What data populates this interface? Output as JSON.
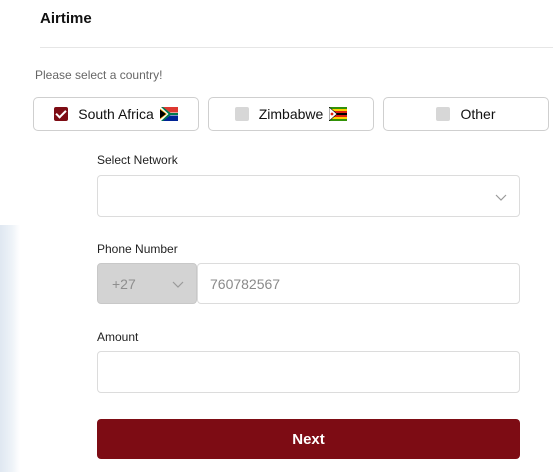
{
  "header": {
    "title": "Airtime"
  },
  "country_select": {
    "prompt": "Please select a country!",
    "options": [
      {
        "label": "South Africa",
        "checked": true,
        "flag": "south-africa-flag-icon"
      },
      {
        "label": "Zimbabwe",
        "checked": false,
        "flag": "zimbabwe-flag-icon"
      },
      {
        "label": "Other",
        "checked": false,
        "flag": ""
      }
    ]
  },
  "network": {
    "label": "Select Network",
    "value": "",
    "icon": "chevron-down-icon"
  },
  "phone": {
    "label": "Phone Number",
    "country_code": "+27",
    "placeholder": "760782567",
    "value": ""
  },
  "amount": {
    "label": "Amount",
    "value": ""
  },
  "actions": {
    "next_label": "Next"
  },
  "colors": {
    "accent": "#7d0c14",
    "border": "#dcdcdc",
    "disabled_bg": "#d3d3d3"
  }
}
